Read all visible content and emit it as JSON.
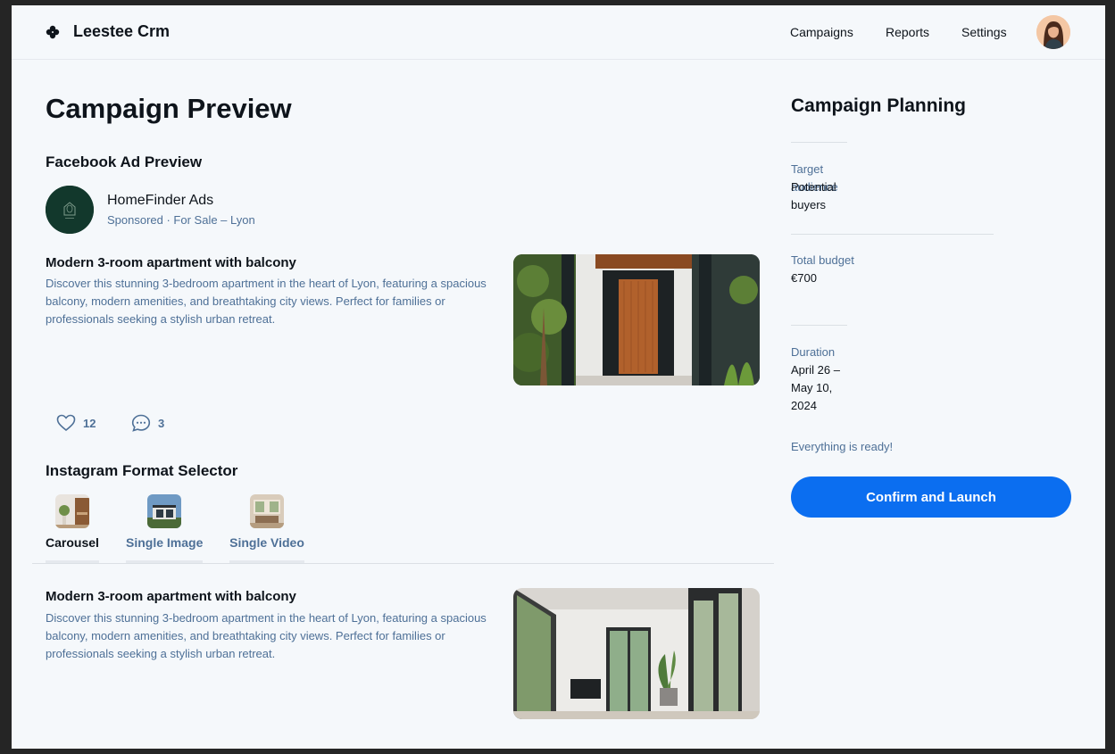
{
  "header": {
    "brand": "Leestee Crm",
    "nav": [
      "Campaigns",
      "Reports",
      "Settings"
    ],
    "logo_icon": "clover-icon"
  },
  "main": {
    "title": "Campaign Preview",
    "facebook": {
      "section_title": "Facebook Ad Preview",
      "page_name": "HomeFinder Ads",
      "page_sub": "Sponsored · For Sale – Lyon",
      "post_heading": "Modern 3-room apartment with balcony",
      "post_body": "Discover this stunning 3-bedroom apartment in the heart of Lyon, featuring a spacious balcony, modern amenities, and breathtaking city views. Perfect for families or professionals seeking a stylish urban retreat.",
      "likes": "12",
      "comments": "3"
    },
    "instagram": {
      "section_title": "Instagram Format Selector",
      "formats": [
        "Carousel",
        "Single Image",
        "Single Video"
      ],
      "active_format": "Carousel",
      "post_heading": "Modern 3-room apartment with balcony",
      "post_body": "Discover this stunning 3-bedroom apartment in the heart of Lyon, featuring a spacious balcony, modern amenities, and breathtaking city views. Perfect for families or professionals seeking a stylish urban retreat."
    }
  },
  "sidebar": {
    "title": "Campaign Planning",
    "target_label": "Target",
    "target_label_2": "audience",
    "target_value": "Potential buyers",
    "budget_label": "Total budget",
    "budget_value": "€700",
    "duration_label": "Duration",
    "duration_value": "April 26 – May 10, 2024",
    "ready_text": "Everything is ready!",
    "launch_label": "Confirm and Launch"
  },
  "colors": {
    "accent": "#0b6ef0",
    "muted_text": "#4e7097",
    "background": "#f5f8fb"
  }
}
